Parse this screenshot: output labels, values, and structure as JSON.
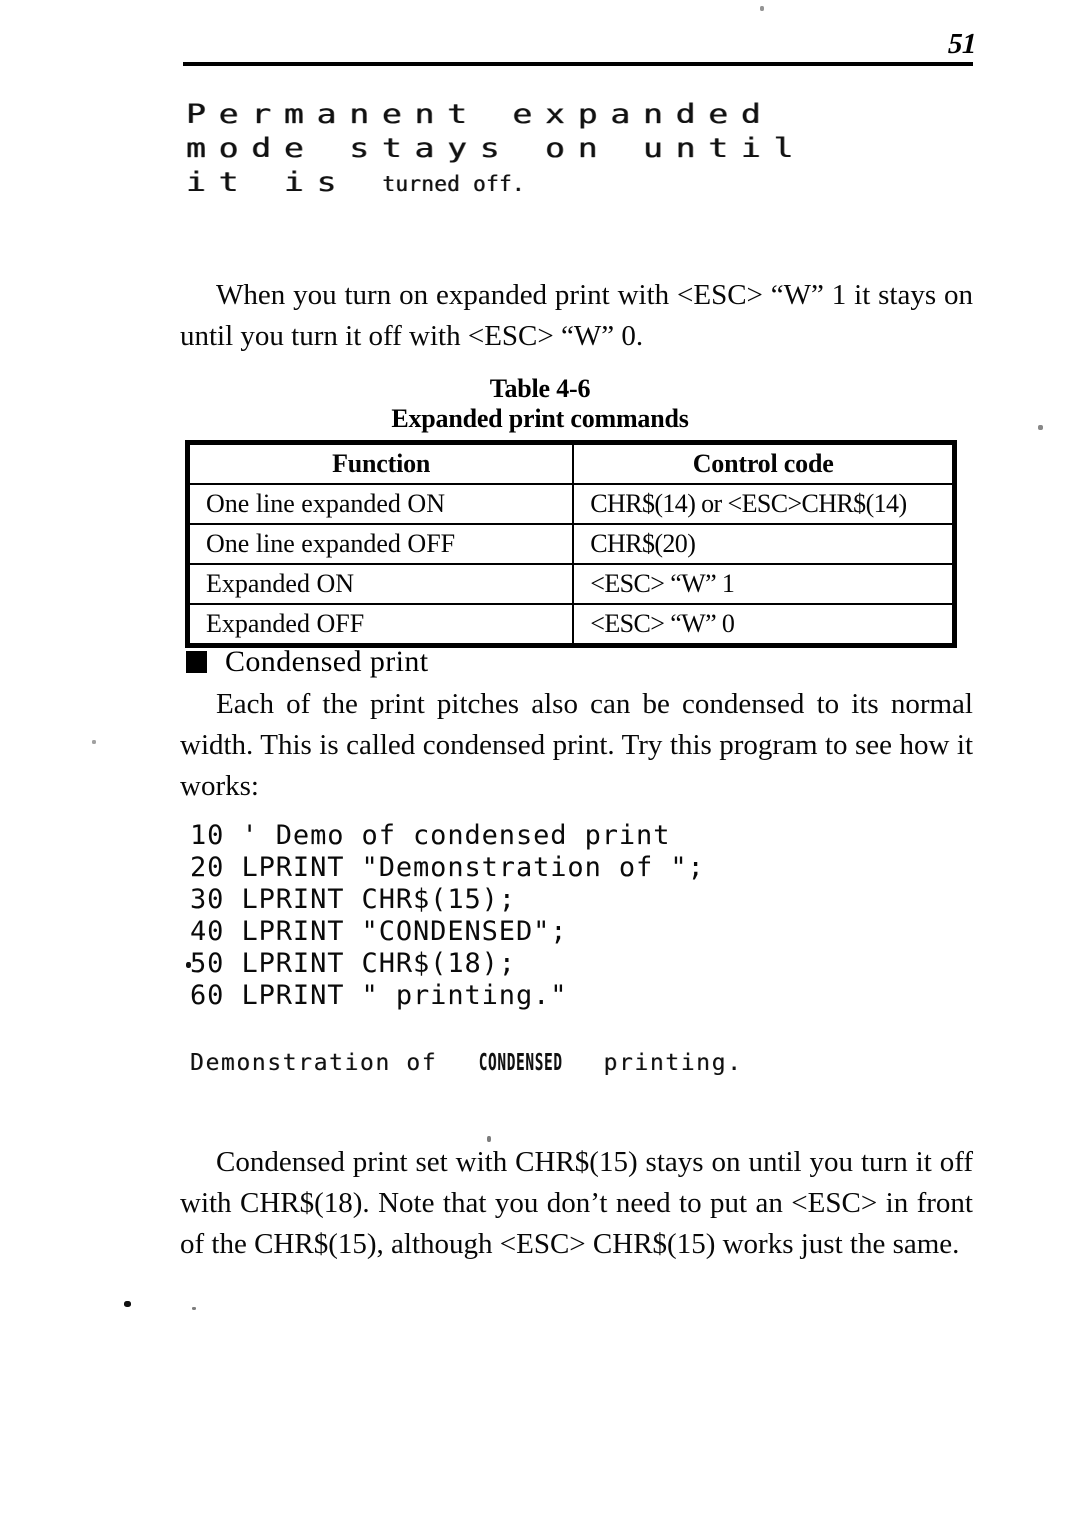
{
  "header": {
    "page_number": "51"
  },
  "printer_samples": {
    "expanded": {
      "line1": "Permanent expanded",
      "line2": "mode stays on until",
      "line3_expanded": "it is ",
      "line3_normal": "turned off."
    },
    "condensed_output": {
      "prefix": "Demonstration of ",
      "emphasis": "CONDENSED",
      "suffix": " printing."
    }
  },
  "body": {
    "para_expanded": "When you turn on expanded print with <ESC> “W” 1 it stays on until you turn it off with <ESC> “W” 0.",
    "para_condensed_intro": "Each of the print pitches also can be condensed to its normal width.  This is called condensed print. Try this program to see how it works:",
    "para_condensed_note": "Condensed print set with CHR$(15) stays on until you turn it off with CHR$(18). Note that you don’t need to put an <ESC> in front of the CHR$(15), although <ESC> CHR$(15) works just the same."
  },
  "table": {
    "caption_line1": "Table 4-6",
    "caption_line2": "Expanded print commands",
    "columns": [
      "Function",
      "Control code"
    ],
    "rows": [
      {
        "function": "One line expanded ON",
        "control_code": "CHR$(14) or  <ESC>CHR$(14)"
      },
      {
        "function": "One line expanded OFF",
        "control_code": "CHR$(20)"
      },
      {
        "function": "Expanded ON",
        "control_code": " <ESC>  “W” 1"
      },
      {
        "function": "Expanded OFF",
        "control_code": " <ESC>  “W” 0"
      }
    ]
  },
  "section": {
    "condensed_print_heading": "Condensed print",
    "bullet_icon": "black-square-bullet"
  },
  "program_listing": {
    "lines": [
      "10 ' Demo of condensed print",
      "20 LPRINT \"Demonstration of \";",
      "30 LPRINT CHR$(15);",
      "40 LPRINT \"CONDENSED\";",
      "50 LPRINT CHR$(18);",
      "60 LPRINT \" printing.\""
    ]
  },
  "colors": {
    "ink": "#000000",
    "paper": "#ffffff"
  }
}
